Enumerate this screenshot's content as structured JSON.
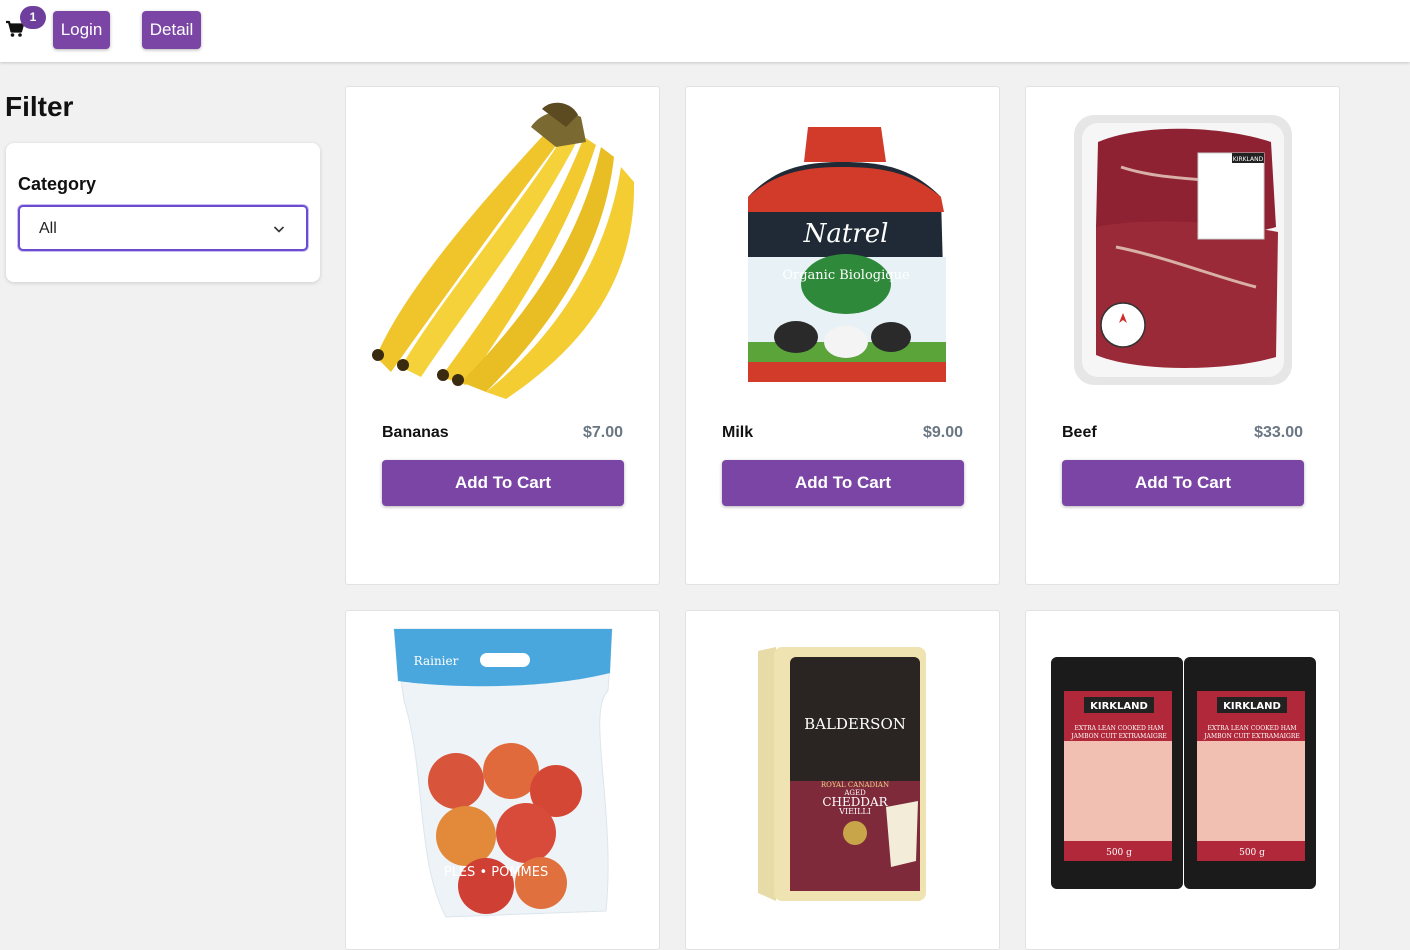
{
  "header": {
    "cart_count": "1",
    "login_label": "Login",
    "detail_label": "Detail"
  },
  "filter": {
    "title": "Filter",
    "category_label": "Category",
    "category_value": "All"
  },
  "products": [
    {
      "name": "Bananas",
      "price": "$7.00",
      "button": "Add To Cart"
    },
    {
      "name": "Milk",
      "price": "$9.00",
      "button": "Add To Cart"
    },
    {
      "name": "Beef",
      "price": "$33.00",
      "button": "Add To Cart"
    }
  ],
  "images": {
    "milk_brand": "Natrel",
    "milk_label": "Organic Biologique",
    "apples_brand": "Rainier",
    "apples_text": "PLES • POMMES",
    "cheese_brand": "BALDERSON",
    "cheese_line1": "ROYAL CANADIAN",
    "cheese_line2": "AGED",
    "cheese_line3": "CHEDDAR",
    "cheese_line4": "VIEILLI",
    "ham_brand": "KIRKLAND",
    "ham_line1": "EXTRA LEAN COOKED HAM",
    "ham_line2": "JAMBON CUIT EXTRAMAIGRE",
    "ham_weight": "500 g",
    "beef_brand": "KIRKLAND"
  },
  "colors": {
    "accent": "#7a45a5",
    "badge": "#6f3f9e",
    "select_border": "#6a4bd2",
    "price": "#6b7683"
  }
}
